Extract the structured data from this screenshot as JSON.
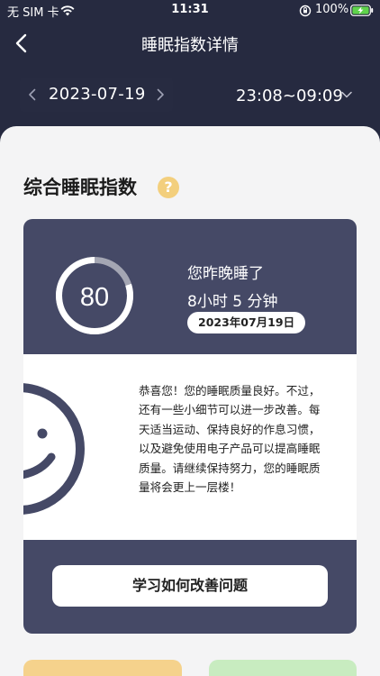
{
  "status_bar": {
    "carrier": "无 SIM 卡",
    "time": "11:31",
    "battery_percent": "100%"
  },
  "nav": {
    "title": "睡眠指数详情"
  },
  "date_selector": {
    "date": "2023-07-19",
    "time_range": "23:08~09:09"
  },
  "section": {
    "title": "综合睡眠指数",
    "help_symbol": "?"
  },
  "score_card": {
    "score": "80",
    "score_fraction": 0.8,
    "headline": "您昨晚睡了",
    "duration": "8小时 5 分钟",
    "date_badge": "2023年07月19日"
  },
  "advice": {
    "text": "恭喜您！您的睡眠质量良好。不过，还有一些小细节可以进一步改善。每天适当运动、保持良好的作息习惯，以及避免使用电子产品可以提高睡眠质量。请继续保持努力，您的睡眠质量将会更上一层楼！"
  },
  "actions": {
    "learn_button": "学习如何改善问题"
  },
  "colors": {
    "background": "#262a40",
    "card": "#454966",
    "ring_track": "#a4a6b3",
    "help_badge": "#f3cf7d",
    "peek_yellow": "#f5d28c",
    "peek_green": "#c8ecc0"
  }
}
